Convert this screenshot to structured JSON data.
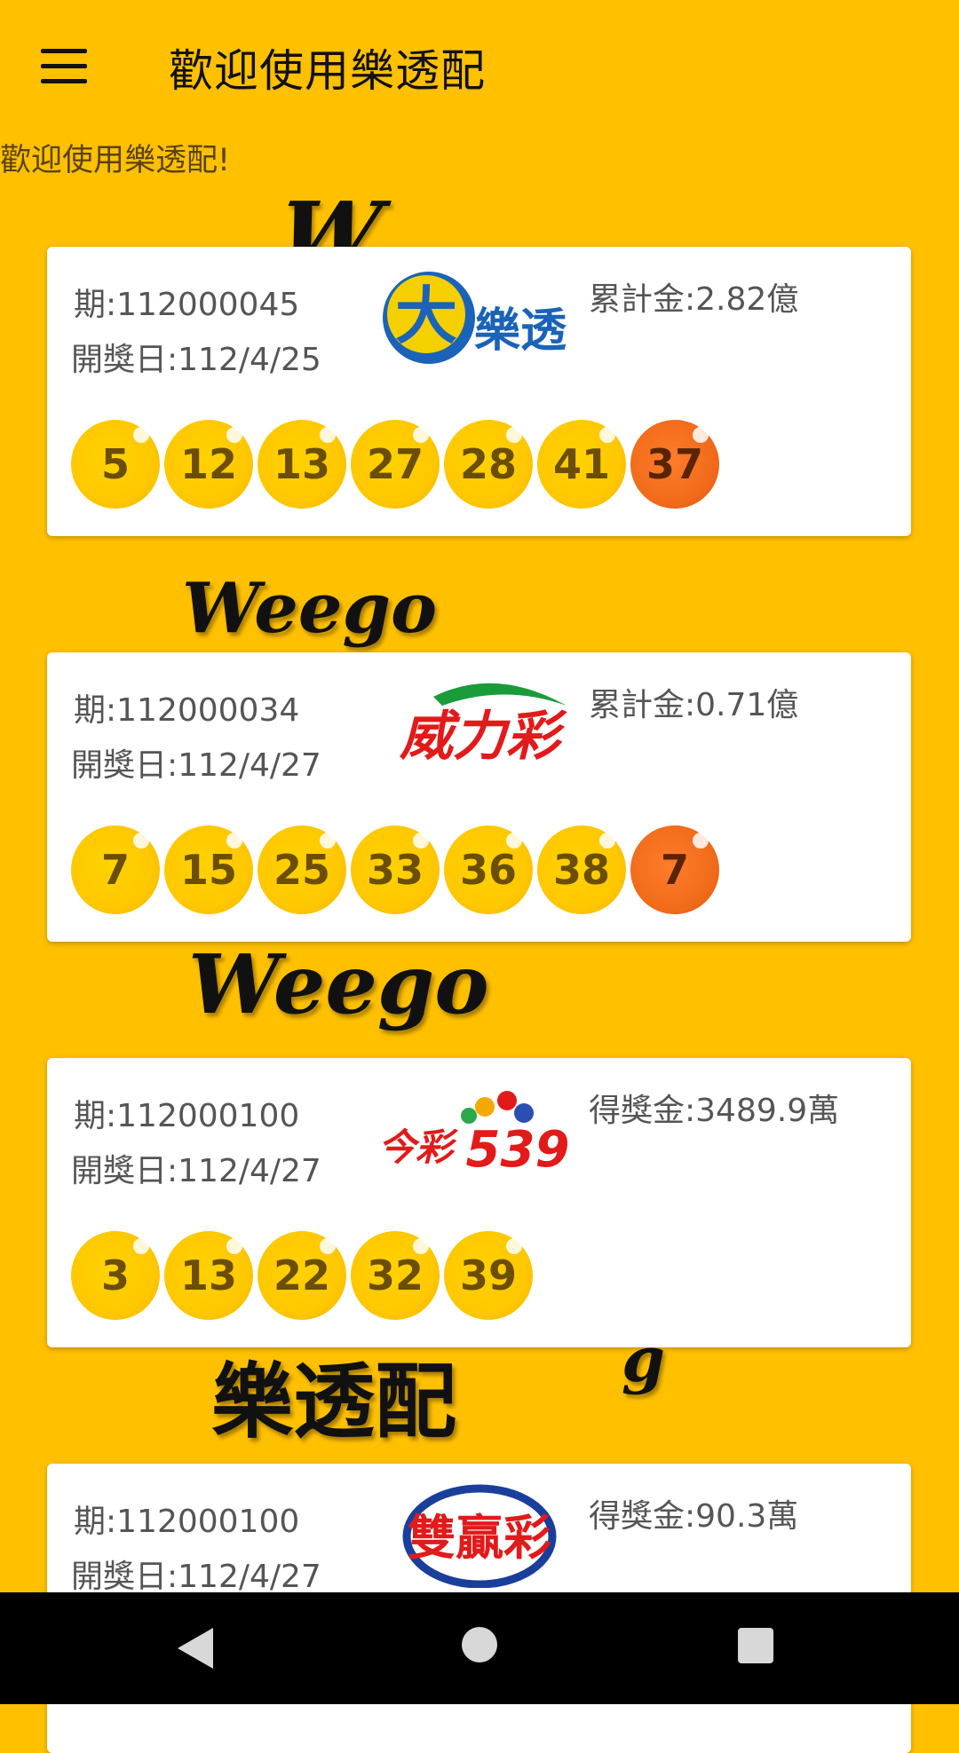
{
  "appbar": {
    "title": "歡迎使用樂透配",
    "menu_icon": "hamburger-menu-icon"
  },
  "welcome_text": "歡迎使用樂透配!",
  "watermark": {
    "brand": "Weego",
    "brand_cn": "樂透配"
  },
  "cards": [
    {
      "period": "期:112000045",
      "date": "開獎日:112/4/25",
      "prize": "累計金:2.82億",
      "logo": {
        "text": "大樂透",
        "colors": [
          "#1a63b8",
          "#f5d000",
          "#e02020"
        ]
      },
      "numbers": [
        "5",
        "12",
        "13",
        "27",
        "28",
        "41"
      ],
      "special": "37"
    },
    {
      "period": "期:112000034",
      "date": "開獎日:112/4/27",
      "prize": "累計金:0.71億",
      "logo": {
        "text": "威力彩",
        "colors": [
          "#e21a1a",
          "#1a9b3a"
        ]
      },
      "numbers": [
        "7",
        "15",
        "25",
        "33",
        "36",
        "38"
      ],
      "special": "7"
    },
    {
      "period": "期:112000100",
      "date": "開獎日:112/4/27",
      "prize": "得獎金:3489.9萬",
      "logo": {
        "text": "今彩539",
        "colors": [
          "#e21a1a",
          "#2a4fb0",
          "#f5a800"
        ]
      },
      "numbers": [
        "3",
        "13",
        "22",
        "32",
        "39"
      ],
      "special": ""
    },
    {
      "period": "期:112000100",
      "date": "開獎日:112/4/27",
      "prize": "得獎金:90.3萬",
      "logo": {
        "text": "雙贏彩",
        "colors": [
          "#e21a1a",
          "#1a3f9b"
        ]
      },
      "numbers": [],
      "special": ""
    }
  ],
  "navbar": {
    "back_icon": "back-triangle-icon",
    "home_icon": "home-circle-icon",
    "recents_icon": "recents-square-icon"
  },
  "colors": {
    "background": "#FFC000",
    "ball": "#FFC800",
    "special_ball": "#F06A1A"
  }
}
